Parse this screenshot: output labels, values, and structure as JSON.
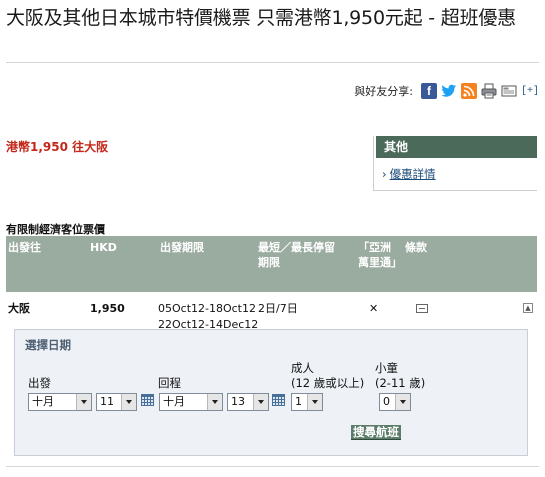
{
  "page": {
    "title": "大阪及其他日本城市特價機票 只需港幣1,950元起 - 超班優惠"
  },
  "share": {
    "label": "與好友分享:",
    "more_label": "[+]",
    "icons": [
      "facebook-icon",
      "twitter-icon",
      "rss-icon",
      "print-icon",
      "email-icon"
    ]
  },
  "price_heading": "港幣1,950 往大阪",
  "sidebar": {
    "heading": "其他",
    "link": "優惠詳情"
  },
  "fare_table": {
    "caption": "有限制經濟客位票價",
    "headers": {
      "destination": "出發往",
      "currency": "HKD",
      "travel_period": "出發期限",
      "stay": "最短／最長停留期限",
      "asia_miles": "「亞洲萬里通」",
      "terms": "條款"
    },
    "rows": [
      {
        "destination": "大阪",
        "price": "1,950",
        "period_1": "05Oct12-18Oct12",
        "period_2": "22Oct12-14Dec12",
        "stay": "2日/7日",
        "asia_miles": "✕"
      }
    ]
  },
  "date_picker": {
    "title": "選擇日期",
    "depart_label": "出發",
    "return_label": "回程",
    "adult_label": "成人",
    "adult_sub": "(12 歲或以上)",
    "child_label": "小童",
    "child_sub": "(2-11 歲)",
    "depart_month": "十月",
    "depart_day": "11",
    "return_month": "十月",
    "return_day": "13",
    "adults": "1",
    "children": "0",
    "search_label": "搜尋航班"
  },
  "colors": {
    "price_red": "#c4271a",
    "sidebar_green": "#4c6a5a",
    "table_header": "#9aab9f",
    "panel_bg": "#eef2f6",
    "link_blue": "#1b4b7a"
  }
}
